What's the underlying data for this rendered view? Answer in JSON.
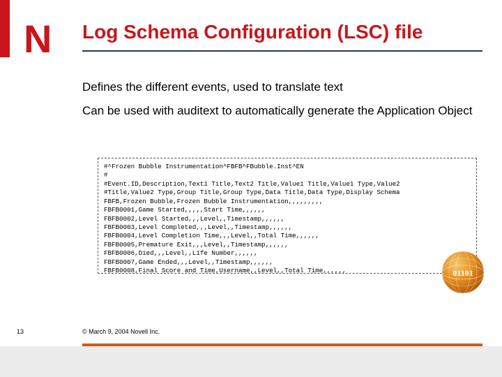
{
  "logo_letter": "N",
  "title": "Log Schema Configuration (LSC) file",
  "paragraphs": {
    "p1": "Defines the different events, used to translate text",
    "p2": "Can be used with auditext to automatically generate the Application Object"
  },
  "code_lines": [
    "#^Frozen Bubble Instrumentation^FBFB^FBubble.Inst^EN",
    "#",
    "#Event.ID,Description,Text1 Title,Text2 Title,Value1 Title,Value1 Type,Value2",
    "#Title,Value2 Type,Group Title,Group Type,Data Title,Data Type,Display Schema",
    "FBFB,Frozen Bubble,Frozen Bubble Instrumentation,,,,,,,,,",
    "FBFB0001,Game Started,,,,,Start Time,,,,,,",
    "FBFB0002,Level Started,,,Level,,Timestamp,,,,,,",
    "FBFB0003,Level Completed,,,Level,,Timestamp,,,,,,",
    "FBFB0004,Level Completion Time,,,Level,,Total Time,,,,,,",
    "FBFB0005,Premature Exit,,,Level,,Timestamp,,,,,,",
    "FBFB0006,Died,,,Level,,Life Number,,,,,,",
    "FBFB0007,Game Ended,,,Level,,Timestamp,,,,,,",
    "FBFB0008,Final Score and Time,Username,,Level,,Total Time,,,,,,"
  ],
  "sphere_label": "01101",
  "page_number": "13",
  "copyright": "© March 9, 2004 Novell Inc.",
  "colors": {
    "brand_red": "#c9161c",
    "rule_dark": "#2c3558",
    "footer_orange": "#d25a16",
    "footer_grey": "#ececec",
    "sphere_fill": "#e08a1e"
  }
}
